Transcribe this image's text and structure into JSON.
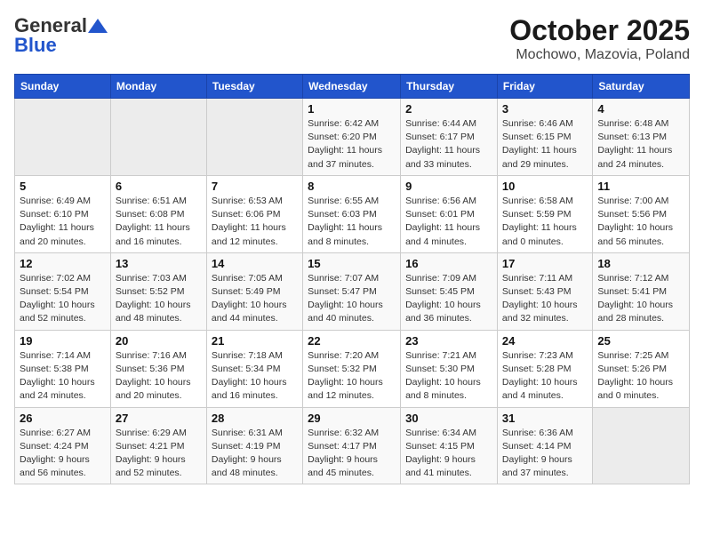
{
  "header": {
    "logo_general": "General",
    "logo_blue": "Blue",
    "month": "October 2025",
    "location": "Mochowo, Mazovia, Poland"
  },
  "days_of_week": [
    "Sunday",
    "Monday",
    "Tuesday",
    "Wednesday",
    "Thursday",
    "Friday",
    "Saturday"
  ],
  "weeks": [
    [
      {
        "day": "",
        "detail": ""
      },
      {
        "day": "",
        "detail": ""
      },
      {
        "day": "",
        "detail": ""
      },
      {
        "day": "1",
        "detail": "Sunrise: 6:42 AM\nSunset: 6:20 PM\nDaylight: 11 hours\nand 37 minutes."
      },
      {
        "day": "2",
        "detail": "Sunrise: 6:44 AM\nSunset: 6:17 PM\nDaylight: 11 hours\nand 33 minutes."
      },
      {
        "day": "3",
        "detail": "Sunrise: 6:46 AM\nSunset: 6:15 PM\nDaylight: 11 hours\nand 29 minutes."
      },
      {
        "day": "4",
        "detail": "Sunrise: 6:48 AM\nSunset: 6:13 PM\nDaylight: 11 hours\nand 24 minutes."
      }
    ],
    [
      {
        "day": "5",
        "detail": "Sunrise: 6:49 AM\nSunset: 6:10 PM\nDaylight: 11 hours\nand 20 minutes."
      },
      {
        "day": "6",
        "detail": "Sunrise: 6:51 AM\nSunset: 6:08 PM\nDaylight: 11 hours\nand 16 minutes."
      },
      {
        "day": "7",
        "detail": "Sunrise: 6:53 AM\nSunset: 6:06 PM\nDaylight: 11 hours\nand 12 minutes."
      },
      {
        "day": "8",
        "detail": "Sunrise: 6:55 AM\nSunset: 6:03 PM\nDaylight: 11 hours\nand 8 minutes."
      },
      {
        "day": "9",
        "detail": "Sunrise: 6:56 AM\nSunset: 6:01 PM\nDaylight: 11 hours\nand 4 minutes."
      },
      {
        "day": "10",
        "detail": "Sunrise: 6:58 AM\nSunset: 5:59 PM\nDaylight: 11 hours\nand 0 minutes."
      },
      {
        "day": "11",
        "detail": "Sunrise: 7:00 AM\nSunset: 5:56 PM\nDaylight: 10 hours\nand 56 minutes."
      }
    ],
    [
      {
        "day": "12",
        "detail": "Sunrise: 7:02 AM\nSunset: 5:54 PM\nDaylight: 10 hours\nand 52 minutes."
      },
      {
        "day": "13",
        "detail": "Sunrise: 7:03 AM\nSunset: 5:52 PM\nDaylight: 10 hours\nand 48 minutes."
      },
      {
        "day": "14",
        "detail": "Sunrise: 7:05 AM\nSunset: 5:49 PM\nDaylight: 10 hours\nand 44 minutes."
      },
      {
        "day": "15",
        "detail": "Sunrise: 7:07 AM\nSunset: 5:47 PM\nDaylight: 10 hours\nand 40 minutes."
      },
      {
        "day": "16",
        "detail": "Sunrise: 7:09 AM\nSunset: 5:45 PM\nDaylight: 10 hours\nand 36 minutes."
      },
      {
        "day": "17",
        "detail": "Sunrise: 7:11 AM\nSunset: 5:43 PM\nDaylight: 10 hours\nand 32 minutes."
      },
      {
        "day": "18",
        "detail": "Sunrise: 7:12 AM\nSunset: 5:41 PM\nDaylight: 10 hours\nand 28 minutes."
      }
    ],
    [
      {
        "day": "19",
        "detail": "Sunrise: 7:14 AM\nSunset: 5:38 PM\nDaylight: 10 hours\nand 24 minutes."
      },
      {
        "day": "20",
        "detail": "Sunrise: 7:16 AM\nSunset: 5:36 PM\nDaylight: 10 hours\nand 20 minutes."
      },
      {
        "day": "21",
        "detail": "Sunrise: 7:18 AM\nSunset: 5:34 PM\nDaylight: 10 hours\nand 16 minutes."
      },
      {
        "day": "22",
        "detail": "Sunrise: 7:20 AM\nSunset: 5:32 PM\nDaylight: 10 hours\nand 12 minutes."
      },
      {
        "day": "23",
        "detail": "Sunrise: 7:21 AM\nSunset: 5:30 PM\nDaylight: 10 hours\nand 8 minutes."
      },
      {
        "day": "24",
        "detail": "Sunrise: 7:23 AM\nSunset: 5:28 PM\nDaylight: 10 hours\nand 4 minutes."
      },
      {
        "day": "25",
        "detail": "Sunrise: 7:25 AM\nSunset: 5:26 PM\nDaylight: 10 hours\nand 0 minutes."
      }
    ],
    [
      {
        "day": "26",
        "detail": "Sunrise: 6:27 AM\nSunset: 4:24 PM\nDaylight: 9 hours\nand 56 minutes."
      },
      {
        "day": "27",
        "detail": "Sunrise: 6:29 AM\nSunset: 4:21 PM\nDaylight: 9 hours\nand 52 minutes."
      },
      {
        "day": "28",
        "detail": "Sunrise: 6:31 AM\nSunset: 4:19 PM\nDaylight: 9 hours\nand 48 minutes."
      },
      {
        "day": "29",
        "detail": "Sunrise: 6:32 AM\nSunset: 4:17 PM\nDaylight: 9 hours\nand 45 minutes."
      },
      {
        "day": "30",
        "detail": "Sunrise: 6:34 AM\nSunset: 4:15 PM\nDaylight: 9 hours\nand 41 minutes."
      },
      {
        "day": "31",
        "detail": "Sunrise: 6:36 AM\nSunset: 4:14 PM\nDaylight: 9 hours\nand 37 minutes."
      },
      {
        "day": "",
        "detail": ""
      }
    ]
  ]
}
